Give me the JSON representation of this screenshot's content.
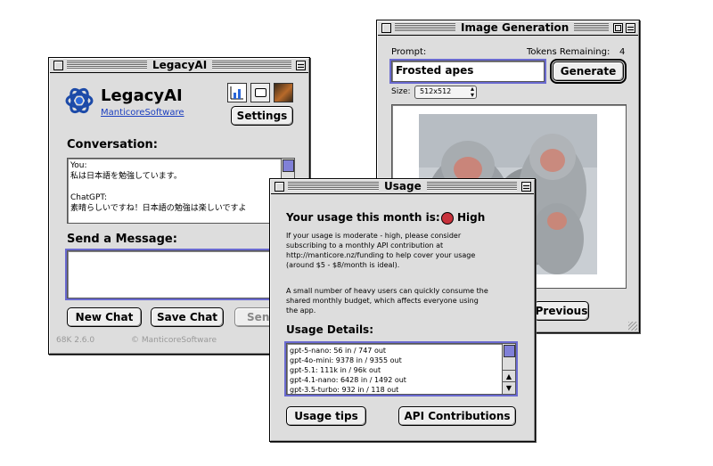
{
  "legacy": {
    "window_title": "LegacyAI",
    "app_name": "LegacyAI",
    "company_link": "ManticoreSoftware",
    "settings_label": "Settings",
    "conversation_label": "Conversation:",
    "conversation_lines": [
      "You:",
      "私は日本語を勉強しています。",
      "",
      "ChatGPT:",
      "素晴らしいですね！日本語の勉強は楽しいですよ"
    ],
    "send_label": "Send a Message:",
    "new_chat_label": "New Chat",
    "save_chat_label": "Save Chat",
    "send_button_label": "Send",
    "version": "68K 2.6.0",
    "copyright": "© ManticoreSoftware"
  },
  "imagegen": {
    "window_title": "Image Generation",
    "prompt_label": "Prompt:",
    "tokens_label": "Tokens Remaining:",
    "tokens_value": "4",
    "prompt_value": "Frosted apes",
    "generate_label": "Generate",
    "size_label": "Size:",
    "size_value": "512x512",
    "previous_label": "Previous"
  },
  "usage": {
    "window_title": "Usage",
    "headline": "Your usage this month is:",
    "level": "High",
    "level_color": "#c8323c",
    "para1": [
      "If your usage is moderate - high, please consider",
      "subscribing to a monthly API contribution at",
      "http://manticore.nz/funding to help cover your usage",
      "(around $5 - $8/month is ideal)."
    ],
    "para2": [
      "A small number of heavy users can quickly consume the",
      "shared monthly budget, which affects everyone using",
      "the app."
    ],
    "details_label": "Usage Details:",
    "details": [
      "gpt-5-nano: 56 in / 747 out",
      "gpt-4o-mini: 9378 in / 9355 out",
      "gpt-5.1: 111k in / 96k out",
      "gpt-4.1-nano: 6428 in / 1492 out",
      "gpt-3.5-turbo: 932 in / 118 out"
    ],
    "tips_label": "Usage tips",
    "contrib_label": "API Contributions"
  }
}
